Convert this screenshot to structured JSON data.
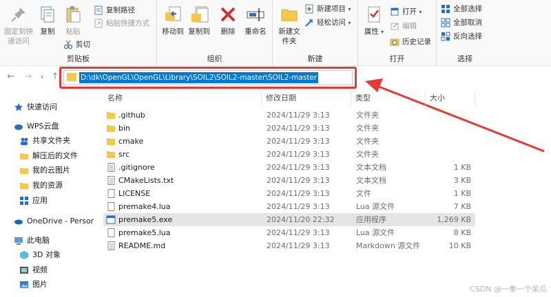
{
  "ribbon": {
    "clipboard": {
      "pin_label": "固定到快速访问",
      "copy_label": "复制",
      "paste_label": "粘贴",
      "copy_path_label": "复制路径",
      "paste_shortcut_label": "粘贴快捷方式",
      "cut_label": "剪切",
      "group_label": "剪贴板"
    },
    "organize": {
      "move_to_label": "移动到",
      "copy_to_label": "复制到",
      "delete_label": "删除",
      "rename_label": "重命名",
      "group_label": "组织"
    },
    "new": {
      "new_folder_label": "新建文件夹",
      "new_item_label": "新建项目",
      "easy_access_label": "轻松访问",
      "group_label": "新建"
    },
    "open": {
      "properties_label": "属性",
      "open_label": "打开",
      "edit_label": "编辑",
      "history_label": "历史记录",
      "group_label": "打开"
    },
    "select": {
      "select_all_label": "全部选择",
      "select_none_label": "全部取消",
      "invert_label": "反向选择",
      "group_label": "选择"
    }
  },
  "address": {
    "path": "D:\\dk\\OpenGL\\OpenGL\\Library\\SOIL2\\SOIL2-master\\SOIL2-master"
  },
  "nav": {
    "items": [
      {
        "label": "快速访问",
        "icon": "star-icon"
      },
      {
        "label": "WPS云盘",
        "icon": "cloud-icon"
      },
      {
        "label": "共享文件夹",
        "icon": "people-icon"
      },
      {
        "label": "解压后的文件",
        "icon": "folder-icon"
      },
      {
        "label": "我的云图片",
        "icon": "folder-icon"
      },
      {
        "label": "我的资源",
        "icon": "folder-icon"
      },
      {
        "label": "应用",
        "icon": "apps-icon"
      },
      {
        "label": "OneDrive - Persor",
        "icon": "onedrive-icon"
      },
      {
        "label": "此电脑",
        "icon": "pc-icon"
      },
      {
        "label": "3D 对象",
        "icon": "cube-icon"
      },
      {
        "label": "视频",
        "icon": "video-icon"
      },
      {
        "label": "图片",
        "icon": "picture-icon"
      }
    ]
  },
  "columns": {
    "name": "名称",
    "date": "修改日期",
    "type": "类型",
    "size": "大小"
  },
  "files": [
    {
      "name": ".github",
      "date": "2024/11/29 3:13",
      "type": "文件夹",
      "size": "",
      "icon": "folder-icon"
    },
    {
      "name": "bin",
      "date": "2024/11/29 3:13",
      "type": "文件夹",
      "size": "",
      "icon": "folder-icon"
    },
    {
      "name": "cmake",
      "date": "2024/11/29 3:13",
      "type": "文件夹",
      "size": "",
      "icon": "folder-icon"
    },
    {
      "name": "src",
      "date": "2024/11/29 3:13",
      "type": "文件夹",
      "size": "",
      "icon": "folder-icon"
    },
    {
      "name": ".gitignore",
      "date": "2024/11/29 3:13",
      "type": "文本文档",
      "size": "1 KB",
      "icon": "text-file-icon"
    },
    {
      "name": "CMakeLists.txt",
      "date": "2024/11/29 3:13",
      "type": "文本文档",
      "size": "3 KB",
      "icon": "text-file-icon"
    },
    {
      "name": "LICENSE",
      "date": "2024/11/29 3:13",
      "type": "文件",
      "size": "1 KB",
      "icon": "file-icon"
    },
    {
      "name": "premake4.lua",
      "date": "2024/11/29 3:13",
      "type": "Lua 源文件",
      "size": "7 KB",
      "icon": "file-icon"
    },
    {
      "name": "premake5.exe",
      "date": "2024/11/20 22:32",
      "type": "应用程序",
      "size": "1,269 KB",
      "icon": "exe-icon"
    },
    {
      "name": "premake5.lua",
      "date": "2024/11/29 3:13",
      "type": "Lua 源文件",
      "size": "8 KB",
      "icon": "file-icon"
    },
    {
      "name": "README.md",
      "date": "2024/11/29 3:13",
      "type": "Markdown 源文件",
      "size": "10 KB",
      "icon": "text-file-icon"
    }
  ],
  "watermark": "CSDN @一拳一个呆瓜",
  "colors": {
    "accent": "#0078d7",
    "highlight": "#e53935",
    "folder": "#f5c84c",
    "selected_row": "#e5e5e5"
  }
}
